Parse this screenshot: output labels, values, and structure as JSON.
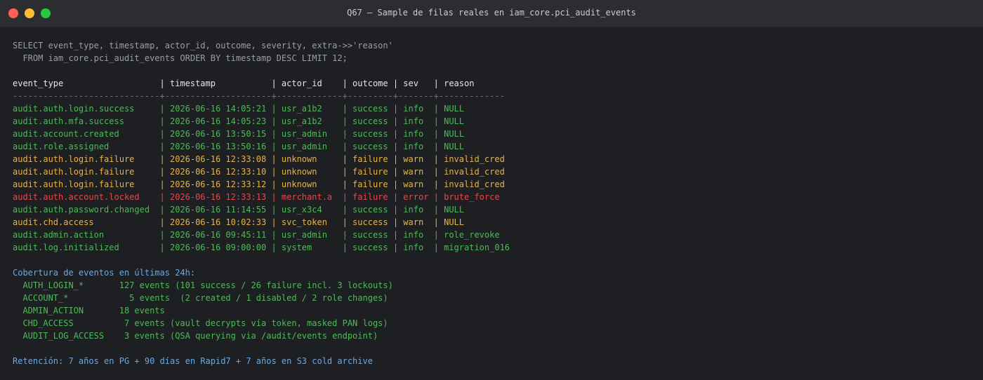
{
  "window": {
    "title": "Q67 — Sample de filas reales en iam_core.pci_audit_events"
  },
  "query": {
    "line1": "SELECT event_type, timestamp, actor_id, outcome, severity, extra->>'reason'",
    "line2": "  FROM iam_core.pci_audit_events ORDER BY timestamp DESC LIMIT 12;"
  },
  "table": {
    "header": "event_type                   | timestamp           | actor_id    | outcome | sev   | reason",
    "separator": "-----------------------------+---------------------+-------------+---------+-------+-------------",
    "rows": [
      {
        "text": "audit.auth.login.success     | 2026-06-16 14:05:21 | usr_a1b2    | success | info  | NULL",
        "status": "success"
      },
      {
        "text": "audit.auth.mfa.success       | 2026-06-16 14:05:23 | usr_a1b2    | success | info  | NULL",
        "status": "success"
      },
      {
        "text": "audit.account.created        | 2026-06-16 13:50:15 | usr_admin   | success | info  | NULL",
        "status": "success"
      },
      {
        "text": "audit.role.assigned          | 2026-06-16 13:50:16 | usr_admin   | success | info  | NULL",
        "status": "success"
      },
      {
        "text": "audit.auth.login.failure     | 2026-06-16 12:33:08 | unknown     | failure | warn  | invalid_cred",
        "status": "warn"
      },
      {
        "text": "audit.auth.login.failure     | 2026-06-16 12:33:10 | unknown     | failure | warn  | invalid_cred",
        "status": "warn"
      },
      {
        "text": "audit.auth.login.failure     | 2026-06-16 12:33:12 | unknown     | failure | warn  | invalid_cred",
        "status": "warn"
      },
      {
        "text": "audit.auth.account.locked    | 2026-06-16 12:33:13 | merchant.a  | failure | error | brute_force",
        "status": "error"
      },
      {
        "text": "audit.auth.password.changed  | 2026-06-16 11:14:55 | usr_x3c4    | success | info  | NULL",
        "status": "success"
      },
      {
        "text": "audit.chd.access             | 2026-06-16 10:02:33 | svc_token   | success | warn  | NULL",
        "status": "warn"
      },
      {
        "text": "audit.admin.action           | 2026-06-16 09:45:11 | usr_admin   | success | info  | role_revoke",
        "status": "success"
      },
      {
        "text": "audit.log.initialized        | 2026-06-16 09:00:00 | system      | success | info  | migration_016",
        "status": "success"
      }
    ]
  },
  "coverage": {
    "heading": "Cobertura de eventos en últimas 24h:",
    "items": [
      "  AUTH_LOGIN_*       127 events (101 success / 26 failure incl. 3 lockouts)",
      "  ACCOUNT_*            5 events  (2 created / 1 disabled / 2 role changes)",
      "  ADMIN_ACTION       18 events",
      "  CHD_ACCESS          7 events (vault decrypts vía token, masked PAN logs)",
      "  AUDIT_LOG_ACCESS    3 events (QSA querying via /audit/events endpoint)"
    ]
  },
  "retention": {
    "text": "Retención: 7 años en PG + 90 días en Rapid7 + 7 años en S3 cold archive"
  },
  "colors": {
    "success": "#4fb85a",
    "warn": "#e6b34a",
    "error": "#e5484d",
    "info": "#6fa8dc"
  }
}
